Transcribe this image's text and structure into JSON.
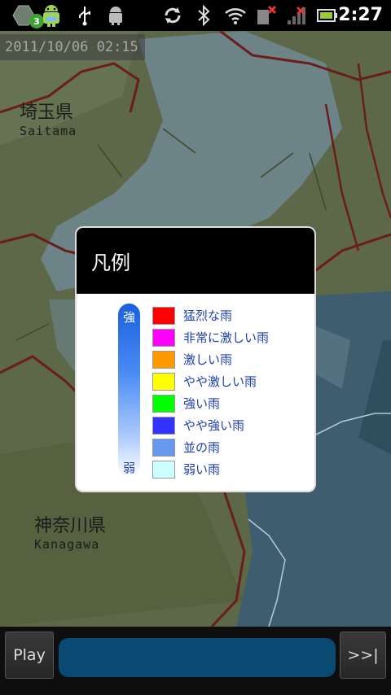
{
  "status_bar": {
    "notification_count": "3",
    "icons": [
      "android-robot-icon",
      "usb-icon",
      "android-debug-icon",
      "sync-icon",
      "bluetooth-icon",
      "wifi-icon",
      "no-sim-icon",
      "signal-icon",
      "battery-icon"
    ],
    "time": "2:27"
  },
  "map": {
    "timestamp": "2011/10/06 02:15",
    "labels": [
      {
        "jp": "埼玉県",
        "en": "Saitama"
      },
      {
        "jp": "神奈川県",
        "en": "Kanagawa"
      }
    ]
  },
  "legend": {
    "title": "凡例",
    "scale_top": "強",
    "scale_bottom": "弱",
    "items": [
      {
        "label": "猛烈な雨",
        "color": "#ff0000"
      },
      {
        "label": "非常に激しい雨",
        "color": "#ff00ff"
      },
      {
        "label": "激しい雨",
        "color": "#ff9900"
      },
      {
        "label": "やや激しい雨",
        "color": "#ffff00"
      },
      {
        "label": "強い雨",
        "color": "#00ff00"
      },
      {
        "label": "やや強い雨",
        "color": "#3333ff"
      },
      {
        "label": "並の雨",
        "color": "#6699ee"
      },
      {
        "label": "弱い雨",
        "color": "#ccffff"
      }
    ]
  },
  "controls": {
    "play_label": "Play",
    "next_label": ">>|"
  }
}
